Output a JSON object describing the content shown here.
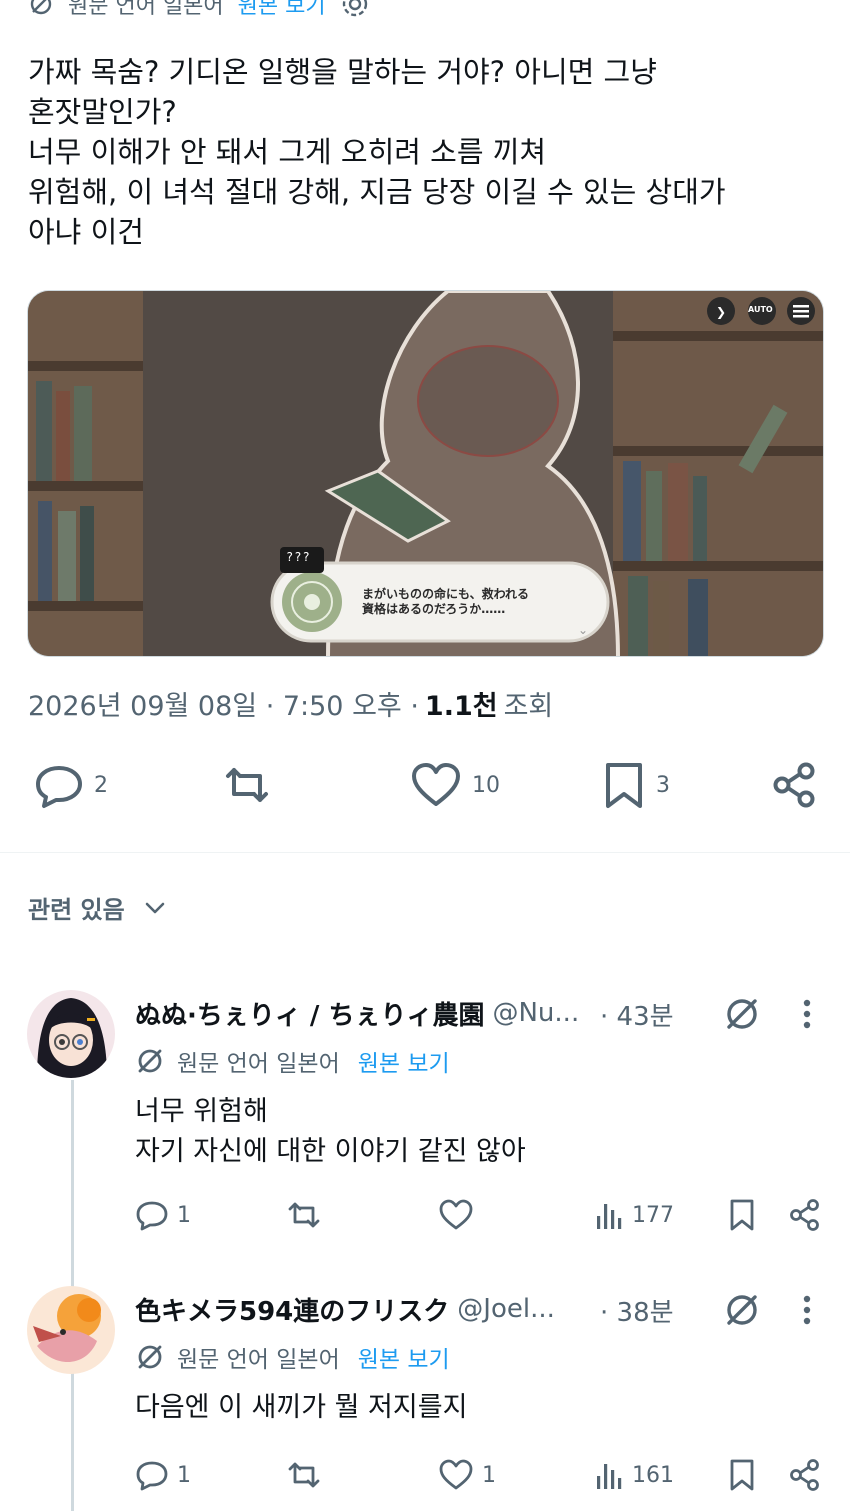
{
  "tweet": {
    "translation_prefix": "원문 언어 일본어",
    "translation_link": "원본 보기",
    "text_lines": [
      "가짜 목숨? 기디온 일행을 말하는 거야? 아니면 그냥",
      "혼잣말인가?",
      "너무 이해가 안 돼서 그게 오히려 소름 끼쳐",
      "위험해, 이 녀석 절대 강해, 지금 당장 이길 수 있는 상대가",
      "아냐 이건"
    ],
    "media": {
      "speaker_label": "???",
      "dialog_line1": "まがいものの命にも、救われる",
      "dialog_line2": "資格はあるのだろうか……",
      "auto_label": "AUTO"
    },
    "date": "2026년 09월 08일 · 7:50 오후 ·",
    "views_count": "1.1천",
    "views_label": "조회",
    "stats": {
      "replies": "2",
      "likes": "10",
      "bookmarks": "3"
    }
  },
  "related": {
    "label": "관련 있음"
  },
  "replies": [
    {
      "name": "ぬぬ·ちぇりィ / ちぇりィ農園",
      "handle": "@Nu...",
      "time": "· 43분",
      "translation_prefix": "원문 언어 일본어",
      "translation_link": "원본 보기",
      "text_lines": [
        "너무 위험해",
        "자기 자신에 대한 이야기 같진 않아"
      ],
      "replies": "1",
      "likes": "",
      "views": "177"
    },
    {
      "name": "色キメラ594連のフリスク",
      "handle": "@Joel...",
      "time": "· 38분",
      "translation_prefix": "원문 언어 일본어",
      "translation_link": "원본 보기",
      "text_lines": [
        "다음엔 이 새끼가 뭘 저지를지"
      ],
      "replies": "1",
      "likes": "1",
      "views": "161"
    }
  ],
  "colors": {
    "text": "#0f1419",
    "secondary": "#536471",
    "link": "#1d9bf0",
    "divider": "#eff3f4"
  }
}
